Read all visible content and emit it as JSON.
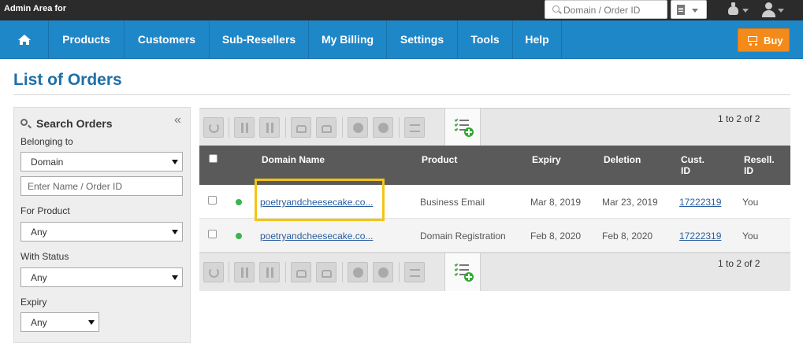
{
  "topbar": {
    "admin_title": "Admin Area for",
    "search_placeholder": "Domain / Order ID"
  },
  "nav": {
    "items": [
      "Products",
      "Customers",
      "Sub-Resellers",
      "My Billing",
      "Settings",
      "Tools",
      "Help"
    ],
    "buy_label": "Buy"
  },
  "page": {
    "title": "List of Orders"
  },
  "sidebar": {
    "heading": "Search Orders",
    "collapse_glyph": "«",
    "belonging_label": "Belonging to",
    "belonging_value": "Domain",
    "name_placeholder": "Enter Name / Order ID",
    "product_label": "For Product",
    "product_value": "Any",
    "status_label": "With Status",
    "status_value": "Any",
    "expiry_label": "Expiry",
    "expiry_value": "Any"
  },
  "pager": {
    "top": "1 to 2 of 2",
    "bottom": "1 to 2 of 2"
  },
  "table": {
    "headers": {
      "domain": "Domain Name",
      "product": "Product",
      "expiry": "Expiry",
      "deletion": "Deletion",
      "cust_id_1": "Cust.",
      "cust_id_2": "ID",
      "resell_id_1": "Resell.",
      "resell_id_2": "ID"
    },
    "rows": [
      {
        "domain": "poetryandcheesecake.co...",
        "product": "Business Email",
        "expiry": "Mar 8, 2019",
        "deletion": "Mar 23, 2019",
        "cust_id": "17222319",
        "resell_id": "You"
      },
      {
        "domain": "poetryandcheesecake.co...",
        "product": "Domain Registration",
        "expiry": "Feb 8, 2020",
        "deletion": "Feb 8, 2020",
        "cust_id": "17222319",
        "resell_id": "You"
      }
    ]
  },
  "colors": {
    "nav_blue": "#1e87c8",
    "buy_orange": "#f48a1a",
    "title_blue": "#1e6fa8",
    "status_green": "#3ab54a",
    "highlight_yellow": "#f5c413"
  }
}
